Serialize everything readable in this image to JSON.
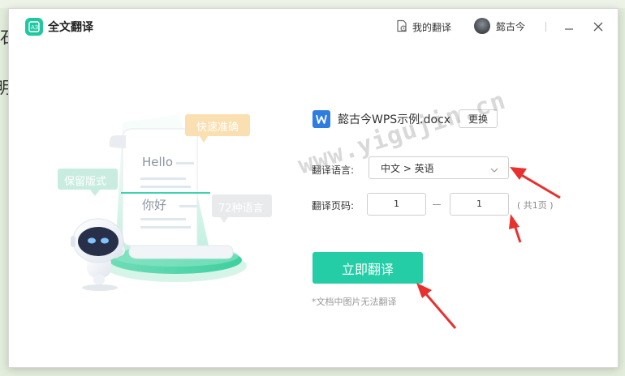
{
  "background": {
    "glyphs": [
      "石",
      "明"
    ]
  },
  "titlebar": {
    "app_title": "全文翻译",
    "my_translations": "我的翻译",
    "username": "懿古今",
    "icons": [
      "translate-app-icon",
      "document-clock-icon",
      "minimize-icon",
      "close-icon"
    ]
  },
  "illustration": {
    "tags": [
      "快速准确",
      "保留版式",
      "72种语言"
    ],
    "doc_text_1": "Hello",
    "doc_text_2": "你好"
  },
  "form": {
    "file_name": "懿古今WPS示例.docx",
    "change_label": "更换",
    "language_label": "翻译语言:",
    "language_value": "中文 > 英语",
    "pages_label": "翻译页码:",
    "page_from": "1",
    "page_to": "1",
    "page_total": "( 共1页 )",
    "translate_button": "立即翻译",
    "note": "*文档中图片无法翻译"
  },
  "watermark": "www.yigujin.cn",
  "colors": {
    "accent": "#25cda6",
    "wps_blue": "#2f7de1",
    "arrow_red": "#e8312f"
  }
}
